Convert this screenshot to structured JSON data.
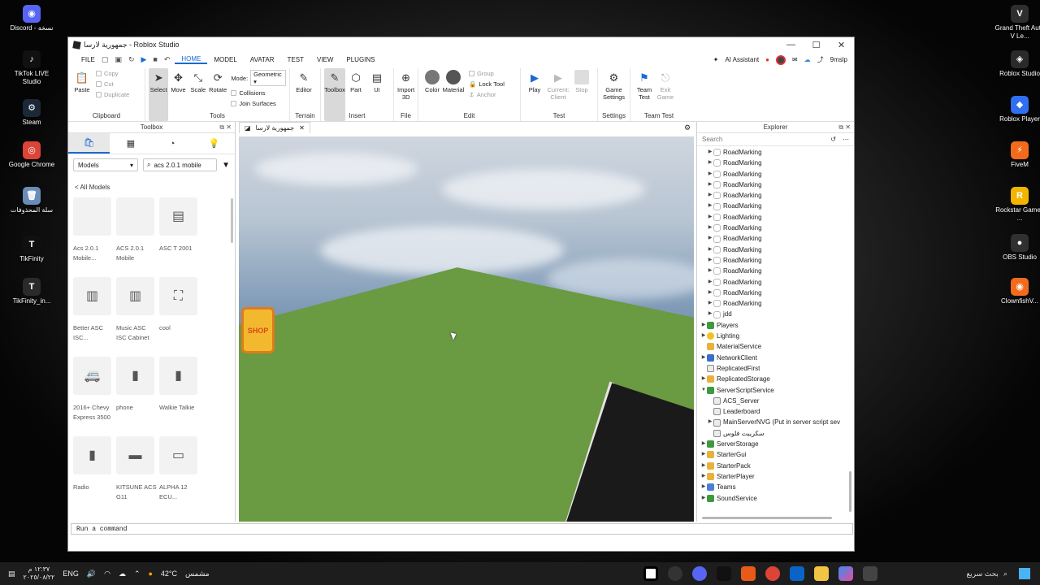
{
  "desktop_left": [
    {
      "label": "Discord - نسخة",
      "color": "#5865f2",
      "glyph": "◉"
    },
    {
      "label": "TikTok LIVE Studio",
      "color": "#111111",
      "glyph": "♪"
    },
    {
      "label": "Steam",
      "color": "#1b2838",
      "glyph": "⚙"
    },
    {
      "label": "Google Chrome",
      "color": "#db4437",
      "glyph": "◎"
    },
    {
      "label": "سلة المحذوفات",
      "color": "#6a8cb8",
      "glyph": "🗑"
    },
    {
      "label": "TikFinity",
      "color": "#101010",
      "glyph": "T"
    },
    {
      "label": "TikFinity_in...",
      "color": "#2a2a2a",
      "glyph": "T"
    }
  ],
  "desktop_right": [
    {
      "label": "Grand Theft Auto V Le...",
      "color": "#2e2e2e",
      "glyph": "V"
    },
    {
      "label": "Roblox Studio",
      "color": "#2a2a2a",
      "glyph": "◈"
    },
    {
      "label": "Roblox Player",
      "color": "#2f6ff0",
      "glyph": "◆"
    },
    {
      "label": "FiveM",
      "color": "#f26b1d",
      "glyph": "⚡"
    },
    {
      "label": "Rockstar Games ...",
      "color": "#f3b400",
      "glyph": "R"
    },
    {
      "label": "OBS Studio",
      "color": "#303030",
      "glyph": "●"
    },
    {
      "label": "ClownfishV...",
      "color": "#f26b1d",
      "glyph": "◉"
    }
  ],
  "window": {
    "title": "جمهورية لارسا - Roblox Studio",
    "controls": [
      "—",
      "☐",
      "✕"
    ]
  },
  "menu": {
    "items": [
      "FILE",
      "HOME",
      "MODEL",
      "AVATAR",
      "TEST",
      "VIEW",
      "PLUGINS"
    ],
    "active": "HOME",
    "ai_assistant": "AI Assistant",
    "username": "9mslp"
  },
  "ribbon": {
    "clipboard": {
      "label": "Clipboard",
      "paste": "Paste",
      "copy": "Copy",
      "cut": "Cut",
      "duplicate": "Duplicate"
    },
    "tools": {
      "label": "Tools",
      "select": "Select",
      "move": "Move",
      "scale": "Scale",
      "rotate": "Rotate",
      "mode_label": "Mode:",
      "mode_value": "Geometric",
      "collisions": "Collisions",
      "join_surfaces": "Join Surfaces"
    },
    "terrain": {
      "label": "Terrain",
      "editor": "Editor"
    },
    "insert": {
      "label": "Insert",
      "toolbox": "Toolbox",
      "part": "Part",
      "ui": "UI"
    },
    "file": {
      "label": "File",
      "import3d": "Import 3D"
    },
    "edit": {
      "label": "Edit",
      "color": "Color",
      "material": "Material",
      "group": "Group",
      "lock_tool": "Lock Tool",
      "anchor": "Anchor"
    },
    "test": {
      "label": "Test",
      "play": "Play",
      "current_client": "Current: Client",
      "stop": "Stop"
    },
    "settings": {
      "label": "Settings",
      "game_settings": "Game Settings"
    },
    "team_test": {
      "label": "Team Test",
      "team_test": "Team Test",
      "exit_game": "Exit Game"
    }
  },
  "toolbox": {
    "title": "Toolbox",
    "category": "Models",
    "query": "acs 2.0.1 mobile",
    "back_link": "< All Models",
    "items": [
      {
        "name": "Acs 2.0.1 Mobile...",
        "glyph": ""
      },
      {
        "name": "ACS 2.0.1 Mobile",
        "glyph": ""
      },
      {
        "name": "ASC T 2001",
        "glyph": "▤"
      },
      {
        "name": "Better ASC ISC...",
        "glyph": "▥"
      },
      {
        "name": "Music ASC ISC Cabinet",
        "glyph": "▥"
      },
      {
        "name": "cool",
        "glyph": "⛶"
      },
      {
        "name": "2016+ Chevy Express 3500",
        "glyph": "🚐"
      },
      {
        "name": "phone",
        "glyph": "▮"
      },
      {
        "name": "Walkie Talkie",
        "glyph": "▮"
      },
      {
        "name": "Radio",
        "glyph": "▮"
      },
      {
        "name": "KITSUNE ACS G11",
        "glyph": "▬"
      },
      {
        "name": "ALPHA 12 ECU...",
        "glyph": "▭"
      }
    ]
  },
  "viewport": {
    "tab_label": "جمهورية لارسا",
    "shop_label": "SHOP"
  },
  "explorer": {
    "title": "Explorer",
    "search_placeholder": "Search",
    "rows": [
      {
        "label": "RoadMarking",
        "indent": 1,
        "arrow": "▶",
        "icon": "part"
      },
      {
        "label": "RoadMarking",
        "indent": 1,
        "arrow": "▶",
        "icon": "part"
      },
      {
        "label": "RoadMarking",
        "indent": 1,
        "arrow": "▶",
        "icon": "part"
      },
      {
        "label": "RoadMarking",
        "indent": 1,
        "arrow": "▶",
        "icon": "part"
      },
      {
        "label": "RoadMarking",
        "indent": 1,
        "arrow": "▶",
        "icon": "part"
      },
      {
        "label": "RoadMarking",
        "indent": 1,
        "arrow": "▶",
        "icon": "part"
      },
      {
        "label": "RoadMarking",
        "indent": 1,
        "arrow": "▶",
        "icon": "part"
      },
      {
        "label": "RoadMarking",
        "indent": 1,
        "arrow": "▶",
        "icon": "part"
      },
      {
        "label": "RoadMarking",
        "indent": 1,
        "arrow": "▶",
        "icon": "part"
      },
      {
        "label": "RoadMarking",
        "indent": 1,
        "arrow": "▶",
        "icon": "part"
      },
      {
        "label": "RoadMarking",
        "indent": 1,
        "arrow": "▶",
        "icon": "part"
      },
      {
        "label": "RoadMarking",
        "indent": 1,
        "arrow": "▶",
        "icon": "part"
      },
      {
        "label": "RoadMarking",
        "indent": 1,
        "arrow": "▶",
        "icon": "part"
      },
      {
        "label": "RoadMarking",
        "indent": 1,
        "arrow": "▶",
        "icon": "part"
      },
      {
        "label": "RoadMarking",
        "indent": 1,
        "arrow": "▶",
        "icon": "part"
      },
      {
        "label": "jdd",
        "indent": 1,
        "arrow": "▶",
        "icon": "part"
      },
      {
        "label": "Players",
        "indent": 0,
        "arrow": "▶",
        "icon": "svc"
      },
      {
        "label": "Lighting",
        "indent": 0,
        "arrow": "▶",
        "icon": "light"
      },
      {
        "label": "MaterialService",
        "indent": 0,
        "arrow": "",
        "icon": "folder"
      },
      {
        "label": "NetworkClient",
        "indent": 0,
        "arrow": "▶",
        "icon": "net"
      },
      {
        "label": "ReplicatedFirst",
        "indent": 0,
        "arrow": "",
        "icon": "script"
      },
      {
        "label": "ReplicatedStorage",
        "indent": 0,
        "arrow": "▶",
        "icon": "folder"
      },
      {
        "label": "ServerScriptService",
        "indent": 0,
        "arrow": "▼",
        "icon": "svc"
      },
      {
        "label": "ACS_Server",
        "indent": 1,
        "arrow": "",
        "icon": "script"
      },
      {
        "label": "Leaderboard",
        "indent": 1,
        "arrow": "",
        "icon": "script"
      },
      {
        "label": "MainServerNVG (Put in server script sev",
        "indent": 1,
        "arrow": "▶",
        "icon": "script"
      },
      {
        "label": "سكريبت فلوس",
        "indent": 1,
        "arrow": "",
        "icon": "script"
      },
      {
        "label": "ServerStorage",
        "indent": 0,
        "arrow": "▶",
        "icon": "svc"
      },
      {
        "label": "StarterGui",
        "indent": 0,
        "arrow": "▶",
        "icon": "folder"
      },
      {
        "label": "StarterPack",
        "indent": 0,
        "arrow": "▶",
        "icon": "folder"
      },
      {
        "label": "StarterPlayer",
        "indent": 0,
        "arrow": "▶",
        "icon": "folder"
      },
      {
        "label": "Teams",
        "indent": 0,
        "arrow": "▶",
        "icon": "team"
      },
      {
        "label": "SoundService",
        "indent": 0,
        "arrow": "▶",
        "icon": "svc"
      }
    ]
  },
  "command_bar": {
    "placeholder": "Run a command"
  },
  "taskbar": {
    "time": "١٢:٣٧ م",
    "date": "٢٠٢٥/٠٨/٢٢",
    "lang": "ENG",
    "temperature": "42°C",
    "weather": "مشمس",
    "search": "بحث سريع"
  }
}
